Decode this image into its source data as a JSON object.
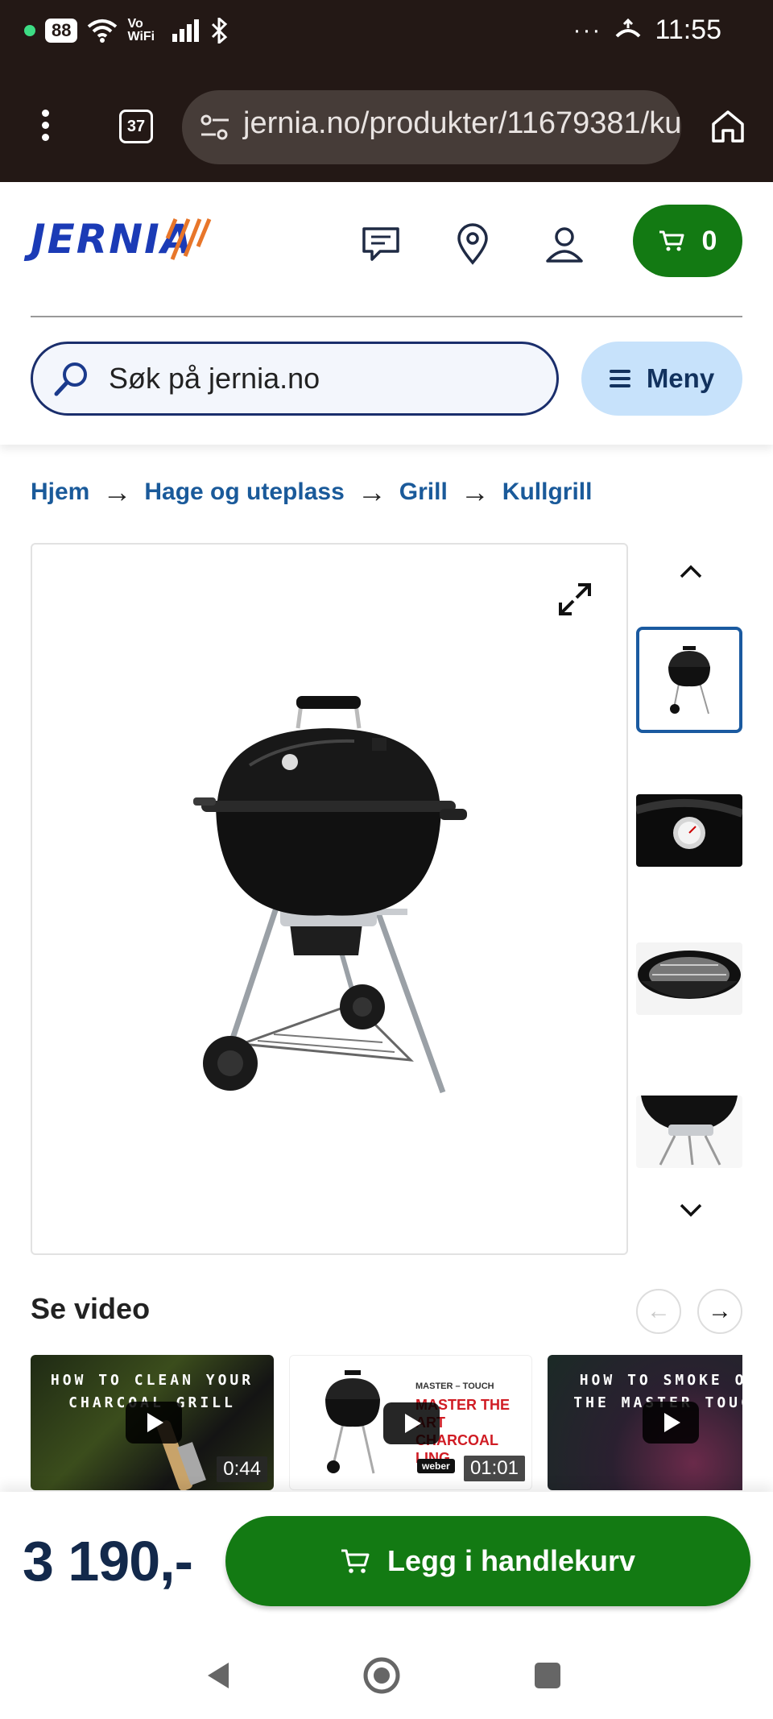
{
  "status_bar": {
    "battery": "88",
    "wifi_label": "Vo WiFi",
    "clock": "11:55"
  },
  "browser": {
    "tab_count": "37",
    "url": "jernia.no/produkter/11679381/ku"
  },
  "header": {
    "logo_text": "JERNIA",
    "cart_count": "0",
    "search_placeholder": "Søk på jernia.no",
    "menu_label": "Meny"
  },
  "breadcrumb": [
    "Hjem",
    "Hage og uteplass",
    "Grill",
    "Kullgrill"
  ],
  "gallery": {
    "thumbnail_count": 4,
    "active_thumbnail": 0
  },
  "videos": {
    "title": "Se video",
    "items": [
      {
        "caption_line1": "HOW TO CLEAN YOUR",
        "caption_line2": "CHARCOAL GRILL",
        "duration": "0:44"
      },
      {
        "caption_top": "MASTER – TOUCH",
        "caption_line1": "MASTER THE ART",
        "caption_line2": "CHARCOAL",
        "caption_line3": "LING",
        "brand": "weber",
        "duration": "01:01"
      },
      {
        "caption_line1": "HOW TO SMOKE ON",
        "caption_line2": "THE MASTER TOUCH",
        "duration": ""
      }
    ]
  },
  "purchase": {
    "price": "3 190,-",
    "add_to_cart_label": "Legg i handlekurv"
  },
  "colors": {
    "brand_green": "#137a13",
    "brand_blue": "#1b3bb6",
    "accent_orange": "#e8762a",
    "link_blue": "#1a5a9a"
  }
}
